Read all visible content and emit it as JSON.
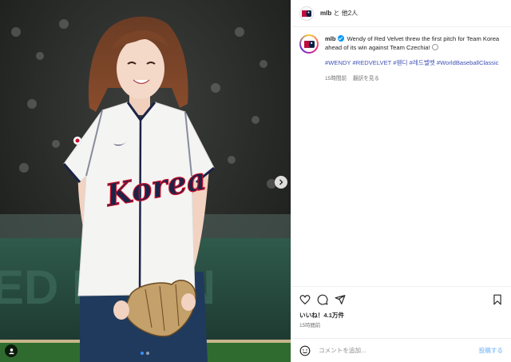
{
  "post_header": {
    "account": "mlb",
    "collab_text": "と 他2人"
  },
  "caption": {
    "user": "mlb",
    "text": "Wendy of Red Velvet threw the first pitch for Team Korea ahead of its win against Team Czechia!",
    "hashtags": [
      "#WENDY",
      "#REDVELVET",
      "#웬디",
      "#레드벨벳",
      "#WorldBaseballClassic"
    ],
    "time": "15時間前",
    "translate": "翻訳を見る"
  },
  "jersey_text": "Korea",
  "engagement": {
    "likes": "いいね！4.1万件",
    "time": "15時間前"
  },
  "composer": {
    "placeholder": "コメントを追加...",
    "post_label": "投稿する"
  },
  "carousel": {
    "count": 2,
    "active": 1
  },
  "colors": {
    "accent": "#0095f6",
    "jersey_navy": "#1c2347",
    "jersey_red": "#c8102e"
  }
}
